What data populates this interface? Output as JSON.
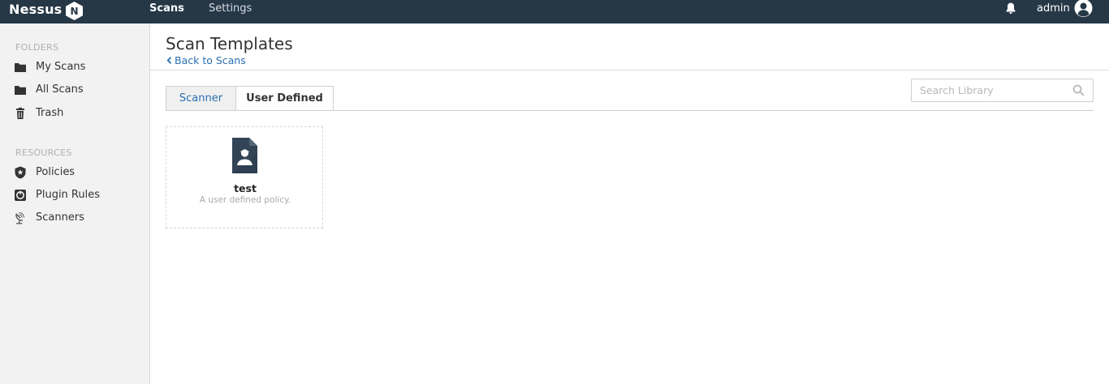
{
  "app": {
    "logo_text": "Nessus",
    "logo_badge": "N"
  },
  "topnav": {
    "items": [
      {
        "label": "Scans",
        "active": true
      },
      {
        "label": "Settings",
        "active": false
      }
    ],
    "username": "admin"
  },
  "sidebar": {
    "folders_header": "FOLDERS",
    "folders": [
      {
        "label": "My Scans",
        "icon": "folder-icon"
      },
      {
        "label": "All Scans",
        "icon": "folder-icon"
      },
      {
        "label": "Trash",
        "icon": "trash-icon"
      }
    ],
    "resources_header": "RESOURCES",
    "resources": [
      {
        "label": "Policies",
        "icon": "policy-shield-icon"
      },
      {
        "label": "Plugin Rules",
        "icon": "plugin-rules-icon"
      },
      {
        "label": "Scanners",
        "icon": "scanner-dish-icon"
      }
    ]
  },
  "main": {
    "title": "Scan Templates",
    "back_link": "Back to Scans",
    "tabs": [
      {
        "label": "Scanner",
        "active": false
      },
      {
        "label": "User Defined",
        "active": true
      }
    ],
    "search": {
      "placeholder": "Search Library",
      "value": ""
    },
    "templates": [
      {
        "name": "test",
        "description": "A user defined policy.",
        "icon": "user-policy-document-icon"
      }
    ]
  },
  "colors": {
    "topbar": "#263746",
    "sidebar_bg": "#f2f2f2",
    "link": "#2a6fb0"
  }
}
